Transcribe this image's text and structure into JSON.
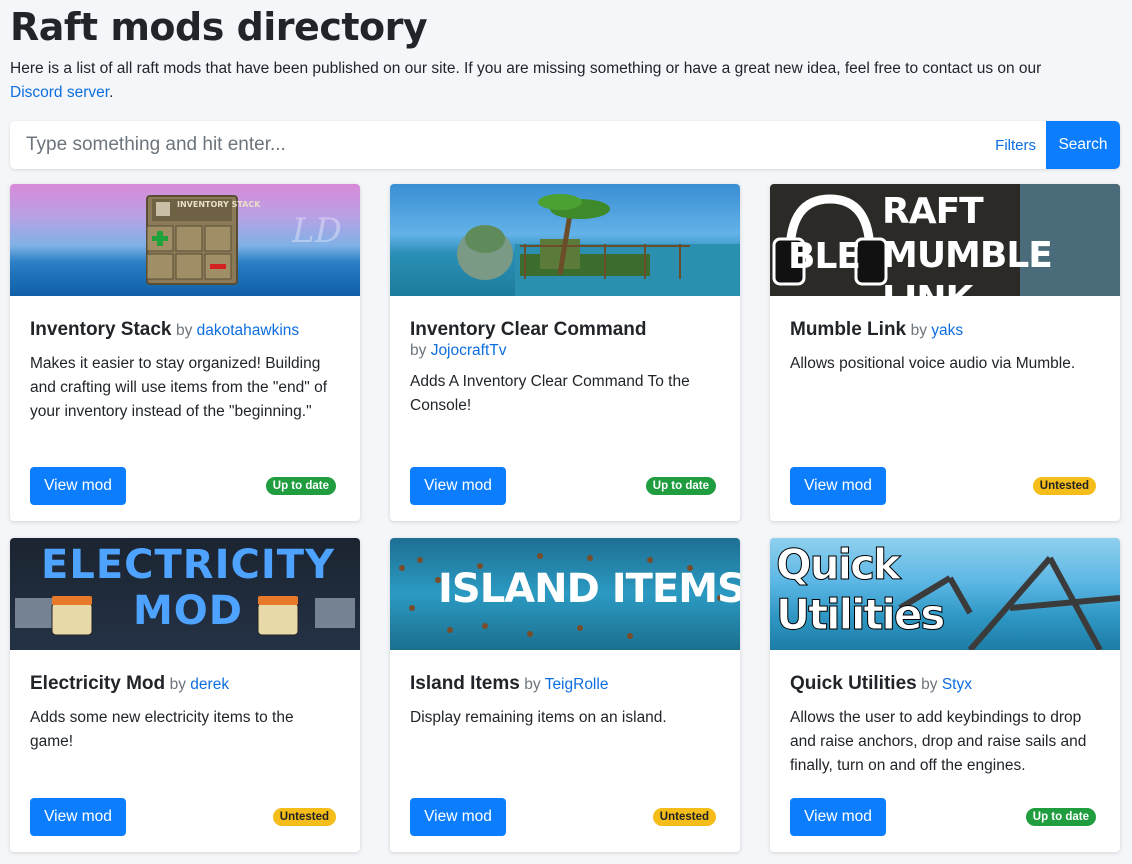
{
  "header": {
    "title": "Raft mods directory",
    "intro": "Here is a list of all raft mods that have been published on our site. If you are missing something or have a great new idea, feel free to contact us on our",
    "discord_link": "Discord server",
    "intro_end": "."
  },
  "search": {
    "placeholder": "Type something and hit enter...",
    "filters_label": "Filters",
    "button_label": "Search"
  },
  "colors": {
    "accent": "#0b7dfd",
    "up_to_date": "#1f9d3f",
    "untested": "#f5bd1a"
  },
  "mods": [
    {
      "name": "Inventory Stack",
      "by": "by",
      "author": "dakotahawkins",
      "description": "Makes it easier to stay organized! Building and crafting will use items from the \"end\" of your inventory instead of the \"beginning.\"",
      "button": "View mod",
      "status": "Up to date",
      "banner_text": "INVENTORY STACK"
    },
    {
      "name": "Inventory Clear Command",
      "by": "by",
      "author": "JojocraftTv",
      "description": "Adds A Inventory Clear Command To the Console!",
      "button": "View mod",
      "status": "Up to date"
    },
    {
      "name": "Mumble Link",
      "by": "by",
      "author": "yaks",
      "description": "Allows positional voice audio via Mumble.",
      "button": "View mod",
      "status": "Untested",
      "banner_text": "RAFT MUMBLE LINK"
    },
    {
      "name": "Electricity Mod",
      "by": "by",
      "author": "derek",
      "description": "Adds some new electricity items to the game!",
      "button": "View mod",
      "status": "Untested",
      "banner_text": "ELECTRICITY MOD"
    },
    {
      "name": "Island Items",
      "by": "by",
      "author": "TeigRolle",
      "description": "Display remaining items on an island.",
      "button": "View mod",
      "status": "Untested",
      "banner_text": "ISLAND ITEMS"
    },
    {
      "name": "Quick Utilities",
      "by": "by",
      "author": "Styx",
      "description": "Allows the user to add keybindings to drop and raise anchors, drop and raise sails and finally, turn on and off the engines.",
      "button": "View mod",
      "status": "Up to date",
      "banner_text": "Quick Utilities"
    }
  ]
}
